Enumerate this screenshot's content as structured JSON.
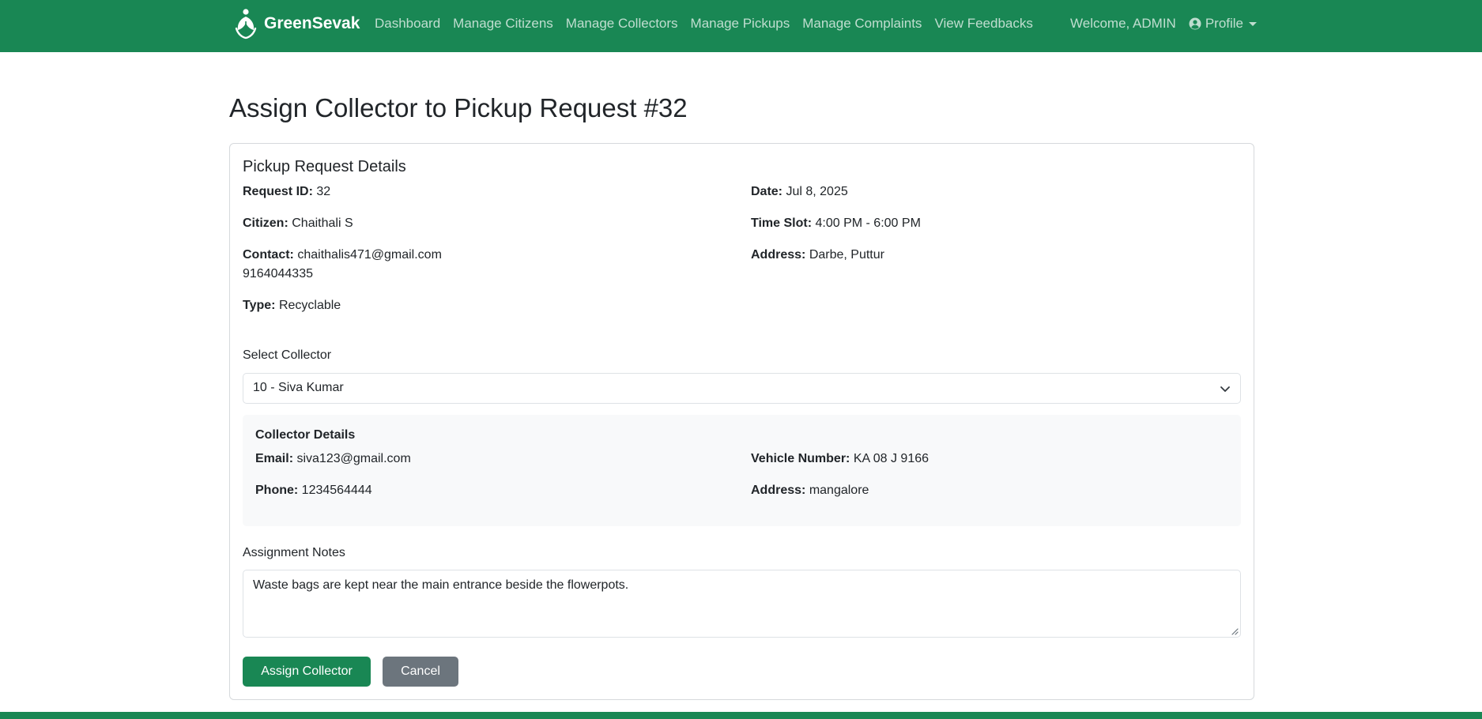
{
  "navbar": {
    "brand": "GreenSevak",
    "links": [
      "Dashboard",
      "Manage Citizens",
      "Manage Collectors",
      "Manage Pickups",
      "Manage Complaints",
      "View Feedbacks"
    ],
    "welcome": "Welcome, ADMIN",
    "profile": "Profile",
    "icons": {
      "logo": "leaf-hand-logo-icon",
      "profile": "person-circle-icon",
      "caret": "caret-down-icon"
    },
    "color": "#198754"
  },
  "page": {
    "title": "Assign Collector to Pickup Request #32"
  },
  "pickup": {
    "heading": "Pickup Request Details",
    "request_id": {
      "label": "Request ID:",
      "value": "32"
    },
    "date": {
      "label": "Date:",
      "value": "Jul 8, 2025"
    },
    "citizen": {
      "label": "Citizen:",
      "value": "Chaithali S"
    },
    "time_slot": {
      "label": "Time Slot:",
      "value": "4:00 PM - 6:00 PM"
    },
    "contact": {
      "label": "Contact:",
      "email": "chaithalis471@gmail.com",
      "phone": "9164044335"
    },
    "address": {
      "label": "Address:",
      "value": "Darbe, Puttur"
    },
    "type": {
      "label": "Type:",
      "value": "Recyclable"
    }
  },
  "select_collector": {
    "label": "Select Collector",
    "value": "10 - Siva Kumar"
  },
  "collector": {
    "heading": "Collector Details",
    "email": {
      "label": "Email:",
      "value": "siva123@gmail.com"
    },
    "vehicle": {
      "label": "Vehicle Number:",
      "value": "KA 08 J 9166"
    },
    "phone": {
      "label": "Phone:",
      "value": "1234564444"
    },
    "address": {
      "label": "Address:",
      "value": "mangalore"
    }
  },
  "notes": {
    "label": "Assignment Notes",
    "value": "Waste bags are kept near the main entrance beside the flowerpots."
  },
  "buttons": {
    "assign": "Assign Collector",
    "cancel": "Cancel"
  },
  "colors": {
    "primary": "#198754",
    "secondary": "#6c757d",
    "panel": "#f8f9fa"
  }
}
